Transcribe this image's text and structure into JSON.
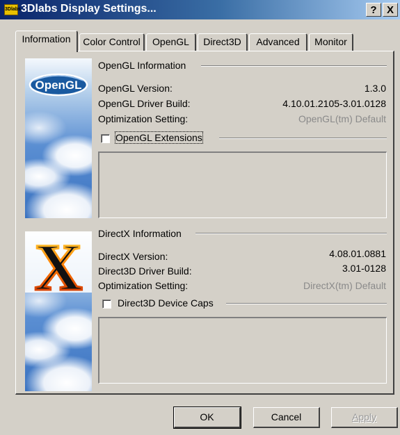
{
  "window": {
    "title": "3Dlabs Display Settings...",
    "app_icon_text": "3Dlabs",
    "help_glyph": "?",
    "close_glyph": "X"
  },
  "tabs": [
    {
      "label": "Information",
      "active": true
    },
    {
      "label": "Color Control",
      "active": false
    },
    {
      "label": "OpenGL",
      "active": false
    },
    {
      "label": "Direct3D",
      "active": false
    },
    {
      "label": "Advanced",
      "active": false
    },
    {
      "label": "Monitor",
      "active": false
    }
  ],
  "opengl": {
    "logo_text": "OpenGL",
    "section_title": "OpenGL Information",
    "version_label": "OpenGL Version:",
    "version_value": "1.3.0",
    "driver_label": "OpenGL Driver Build:",
    "driver_value": "4.10.01.2105-3.01.0128",
    "optimization_label": "Optimization Setting:",
    "optimization_value": "OpenGL(tm) Default",
    "extensions_label": "OpenGL Extensions",
    "extensions_checked": false
  },
  "directx": {
    "logo_text": "X",
    "section_title": "DirectX Information",
    "version_label": "DirectX Version:",
    "version_value": "4.08.01.0881",
    "driver_label": "Direct3D Driver Build:",
    "driver_value": "3.01-0128",
    "optimization_label": "Optimization Setting:",
    "optimization_value": "DirectX(tm) Default",
    "caps_label": "Direct3D Device Caps",
    "caps_checked": false
  },
  "buttons": {
    "ok": "OK",
    "cancel": "Cancel",
    "apply": "Apply"
  }
}
